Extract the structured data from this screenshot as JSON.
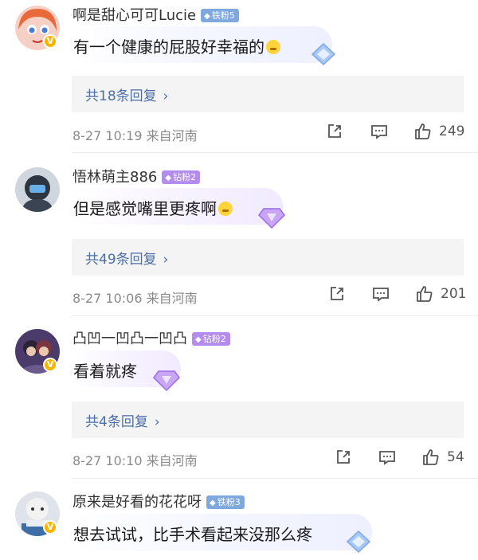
{
  "comments": [
    {
      "username": "啊是甜心可可Lucie",
      "badge": "铁粉5",
      "badge_type": "iron",
      "text": "有一个健康的屁股好幸福的",
      "emoji": "crying-laugh-emoji",
      "replies_label": "共18条回复",
      "meta": "8-27 10:19  来自河南",
      "likes": "249",
      "verified": true
    },
    {
      "username": "悟林萌主886",
      "badge": "钻粉2",
      "badge_type": "drill",
      "text": "但是感觉嘴里更疼啊",
      "emoji": "laughing-emoji",
      "replies_label": "共49条回复",
      "meta": "8-27 10:06  来自河南",
      "likes": "201",
      "verified": false
    },
    {
      "username": "凸凹一凹凸一凹凸",
      "badge": "钻粉2",
      "badge_type": "drill",
      "text": "看着就疼",
      "emoji": "",
      "replies_label": "共4条回复",
      "meta": "8-27 10:10  来自河南",
      "likes": "54",
      "verified": true
    },
    {
      "username": "原来是好看的花花呀",
      "badge": "铁粉3",
      "badge_type": "iron",
      "text": "想去试试，比手术看起来没那么疼",
      "emoji": "",
      "verified": true
    }
  ],
  "icons": {
    "share": "share-icon",
    "comment": "comment-icon",
    "like": "thumbs-up-icon",
    "chevron": "chevron-right-icon"
  },
  "colors": {
    "link": "#4a6ea5",
    "iron_badge": "#7fa8df",
    "drill_badge": "#b48cf0",
    "verified": "#f7b500"
  }
}
